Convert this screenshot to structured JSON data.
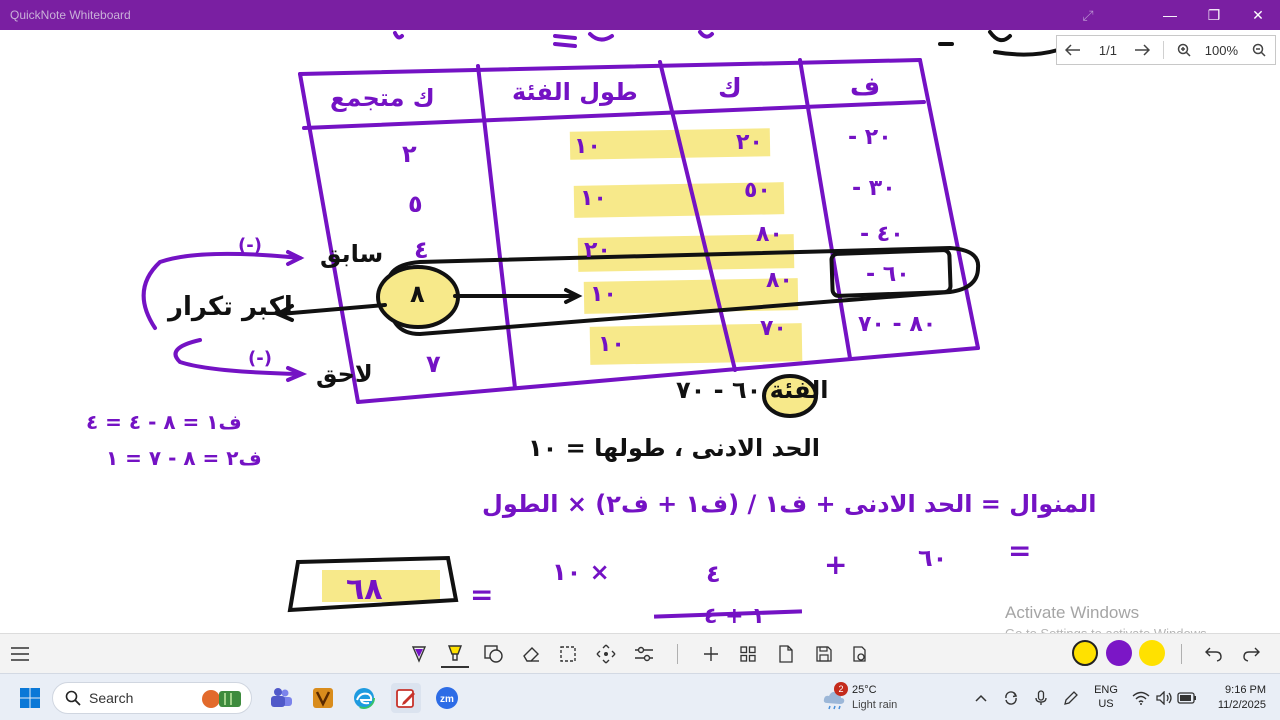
{
  "window": {
    "title": "QuickNote Whiteboard"
  },
  "pager": {
    "page_indicator": "1/1",
    "zoom_level": "100%"
  },
  "watermark": {
    "line1": "Activate Windows",
    "line2": "Go to Settings to activate Windows."
  },
  "toolbar": {
    "colors": [
      "#ffe100",
      "#7b16c6",
      "#ffe100"
    ]
  },
  "taskbar": {
    "search_placeholder": "Search",
    "weather_badge": "2",
    "weather_temp": "25°C",
    "weather_condition": "Light rain",
    "language": "ENG",
    "region": "US",
    "time": "9:16 PM",
    "date": "11/2/2025"
  },
  "board": {
    "ink_color": "#7412c4",
    "highlight_color": "#f7e98a",
    "outline_color": "#111111",
    "table_headers": [
      "ك متجمع",
      "طول الفئة",
      "ك",
      "ف"
    ],
    "class_col": [
      "٢٠ -",
      "٣٠ -",
      "٤٠ -",
      "٦٠ -",
      "٨٠ - ٧٠"
    ],
    "freq_col": [
      "٢٠",
      "٥٠",
      "٨٠",
      "٨٠",
      "٧٠"
    ],
    "length_col": [
      "١٠",
      "١٠",
      "٢٠",
      "١٠",
      "١٠"
    ],
    "adjusted_col": [
      "٢",
      "٥",
      "٤",
      "٨",
      "٧"
    ],
    "label_prev": "سابق",
    "label_max": "اكبر تكرار",
    "label_next": "لاحق",
    "label_minus": "(-)",
    "class_note": "الفئة ٦٠ - ٧٠",
    "lower_note": "الحد الادنى ، طولها = ١٠",
    "f1": "ف١ = ٨ - ٤ = ٤",
    "f2": "ف٢ = ٨ - ٧ = ١",
    "formula": "المنوال = الحد الادنى + ف١ / (ف١ + ف٢) × الطول",
    "sub_eq": "=",
    "sub_sixty": "٦٠",
    "sub_plus": "+",
    "sub_num": "٤",
    "sub_den": "١ + ٤",
    "sub_times": "× ١٠",
    "answer": "٦٨"
  }
}
